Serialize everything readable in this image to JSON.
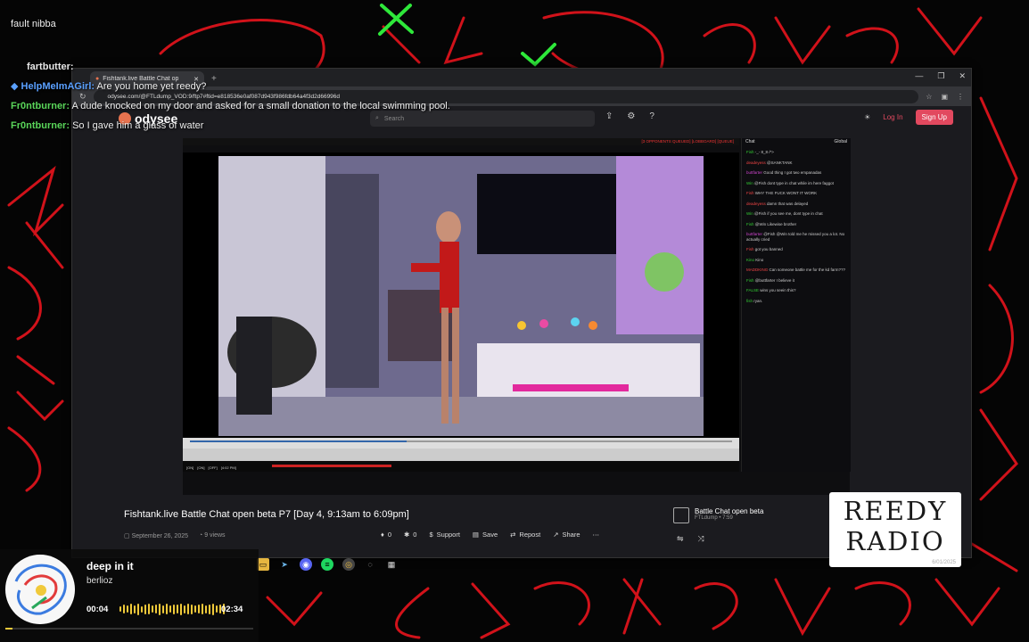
{
  "overlay_chat": {
    "first_line": "fault nibba",
    "messages": [
      {
        "user": "fartbutter:",
        "text": "",
        "color": "#e8e8e8"
      },
      {
        "user": "HelpMeImAGirl:",
        "text": "Are you home yet reedy?",
        "color": "#5aa0ff"
      },
      {
        "user": "Fr0ntburner:",
        "text": "A dude knocked on my door and asked for a small donation to the local swimming pool.",
        "color": "#5ad65a"
      },
      {
        "user": "Fr0ntburner:",
        "text": "So I gave him a glass of water",
        "color": "#5ad65a"
      }
    ]
  },
  "browser": {
    "tab_title": "Fishtank.live Battle Chat op",
    "url": "odysee.com/@FTLdump_VOD:9/ftp7#ftid=e818536e0af087d943f986fdb64a4f3d2d66996d",
    "window_controls": [
      "—",
      "❐",
      "✕"
    ]
  },
  "odysee": {
    "logo": "odysee",
    "search_placeholder": "Search",
    "login": "Log In",
    "signup": "Sign Up"
  },
  "stream": {
    "topbar": "[3 OPPONENTS QUEUED] [LOBBOARD] [QUEUE]",
    "chat_header_left": "Chat",
    "chat_header_right": "Global",
    "chat_messages": [
      {
        "name": "Fish",
        "text": "-_- 8_8 /*>",
        "c": "g"
      },
      {
        "name": "deadeyess",
        "text": "@SANKTANK",
        "c": "r"
      },
      {
        "name": "buttfarter",
        "text": "Good thing I got two empanadas",
        "c": "p"
      },
      {
        "name": "Win",
        "text": "@Fish dont type in chat while im here faggot",
        "c": "g"
      },
      {
        "name": "Fish",
        "text": "WHY THE FUCK WONT IT WORK",
        "c": "r"
      },
      {
        "name": "deadeyess",
        "text": "damn that was delayed",
        "c": "r"
      },
      {
        "name": "Win",
        "text": "@Fish if you see me, dont type in chat",
        "c": "g"
      },
      {
        "name": "Fish",
        "text": "@Win Likewise brother",
        "c": "g"
      },
      {
        "name": "buttfarter",
        "text": "@Fish @Win told me he missed you a lot. No actually cried",
        "c": "p"
      },
      {
        "name": "Fish",
        "text": "got you banned",
        "c": "r"
      },
      {
        "name": "Kino",
        "text": "Kino",
        "c": "g"
      },
      {
        "name": "MADDKING",
        "text": "Can someone battle me for the kd farm???",
        "c": "r"
      },
      {
        "name": "Fish",
        "text": "@buttfarter I believe it",
        "c": "g"
      },
      {
        "name": "FALSE",
        "text": "wins you seein this?",
        "c": "g"
      },
      {
        "name": "fish",
        "text": "ryan.",
        "c": "g"
      }
    ],
    "status_labels": [
      "[ON]",
      "[ON]",
      "[OFF]",
      "[4:02 PM]"
    ]
  },
  "video_info": {
    "title": "Fishtank.live Battle Chat open beta P7 [Day 4, 9:13am to 6:09pm]",
    "date": "September 26, 2025",
    "views": "9 views",
    "likes": "0",
    "dislikes": "0",
    "actions": [
      "Support",
      "Save",
      "Repost",
      "Share"
    ],
    "related_title": "Battle Chat open beta",
    "related_sub": "FTLdump • 7:59"
  },
  "reedy": {
    "line1": "REEDY",
    "line2": "RADIO",
    "date": "6/01/2025"
  },
  "now_playing": {
    "song": "deep in it",
    "artist": "berlioz",
    "elapsed": "00:04",
    "total": "02:34",
    "progress": 0.03
  },
  "colors": {
    "scribble_red": "#d1121a",
    "scribble_green": "#2ee83a",
    "accent": "#e2495f"
  }
}
